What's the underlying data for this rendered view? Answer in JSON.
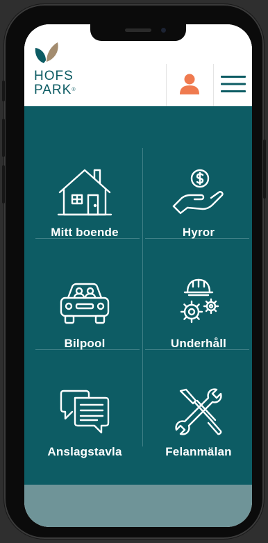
{
  "brand": {
    "line1": "HOFS",
    "line2": "PARK",
    "registered": "®"
  },
  "header": {
    "user_icon": "user-icon",
    "menu_icon": "hamburger-menu-icon"
  },
  "tiles": [
    {
      "label": "Mitt boende",
      "icon": "house-icon"
    },
    {
      "label": "Hyror",
      "icon": "hand-coin-icon"
    },
    {
      "label": "Bilpool",
      "icon": "car-icon"
    },
    {
      "label": "Underhåll",
      "icon": "gears-helmet-icon"
    },
    {
      "label": "Anslagstavla",
      "icon": "chat-bubbles-icon"
    },
    {
      "label": "Felanmälan",
      "icon": "tools-icon"
    }
  ],
  "colors": {
    "primary": "#0d5c64",
    "accent": "#ef7a4f",
    "footer": "#6f9498",
    "logo_leaf_light": "#a38c6f",
    "logo_leaf_dark": "#0c5b63"
  }
}
